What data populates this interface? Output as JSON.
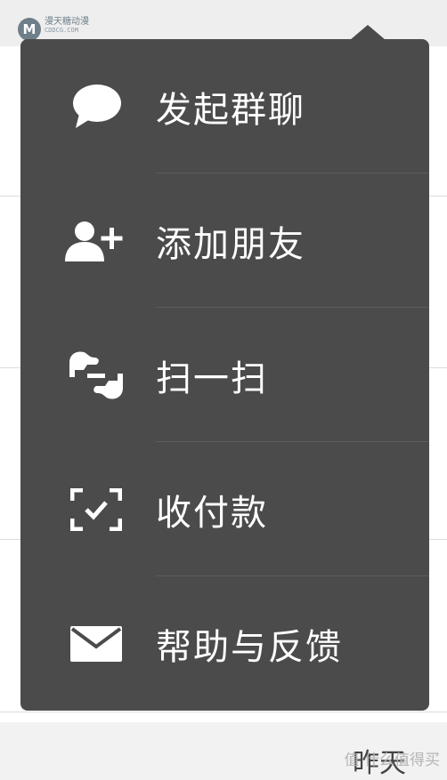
{
  "watermark": {
    "logo_letter": "M",
    "site_name": "漫天糖动漫",
    "site_url": "CDDCG.COM",
    "bottom_right": "值 什么值得买",
    "bottom_text": "昨天"
  },
  "menu": {
    "background_color": "#4b4b4b",
    "text_color": "#ffffff",
    "items": [
      {
        "label": "发起群聊",
        "icon": "chat-bubble-icon"
      },
      {
        "label": "添加朋友",
        "icon": "add-friend-icon"
      },
      {
        "label": "扫一扫",
        "icon": "scan-icon"
      },
      {
        "label": "收付款",
        "icon": "pay-scan-icon"
      },
      {
        "label": "帮助与反馈",
        "icon": "mail-icon"
      }
    ]
  }
}
